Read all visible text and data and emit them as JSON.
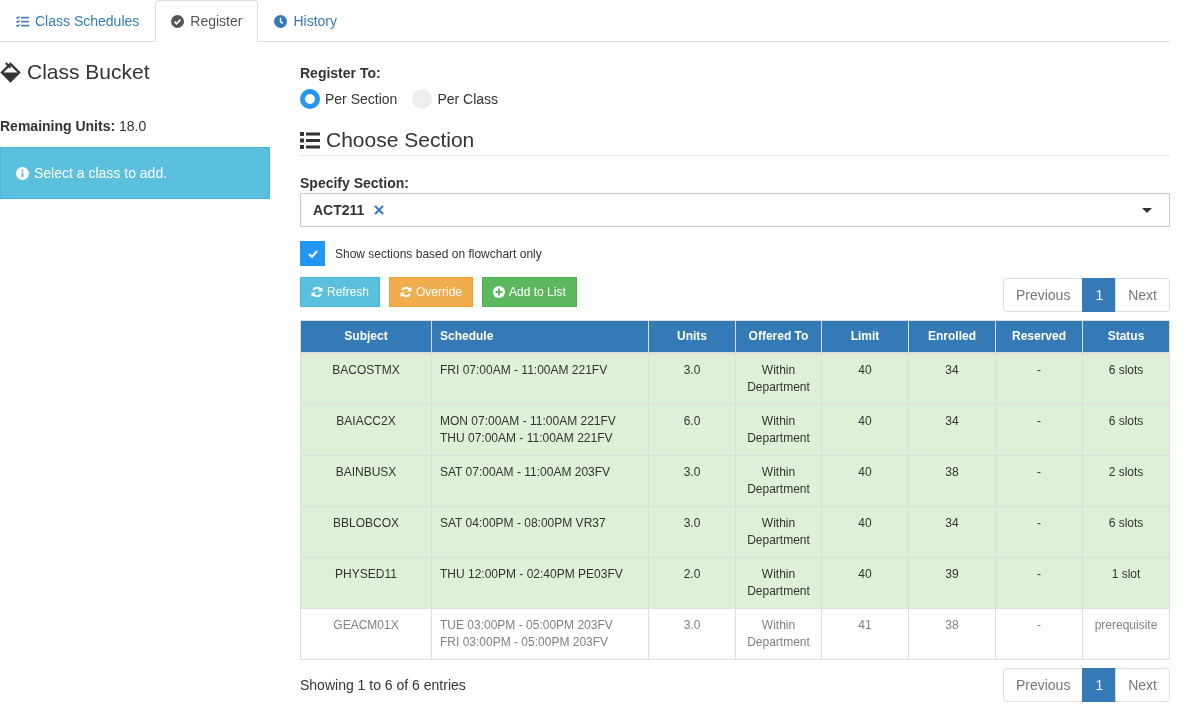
{
  "tabs": [
    {
      "label": "Class Schedules",
      "selected": false
    },
    {
      "label": "Register",
      "selected": true
    },
    {
      "label": "History",
      "selected": false
    }
  ],
  "sidebar": {
    "title": "Class Bucket",
    "remaining_units": "**Remaining Units:** 18.0",
    "alert": "Select a class to add."
  },
  "register_to": {
    "label": "Register To:",
    "options": [
      {
        "label": "Per Section",
        "selected": true
      },
      {
        "label": "Per Class",
        "selected": false
      }
    ]
  },
  "section": {
    "title": "Choose Section",
    "field_label": "Specify Section:",
    "selected_values": [
      "ACT211"
    ],
    "flowchart_only": {
      "label": "Show sections based on flowchart only",
      "checked": true
    }
  },
  "buttons": [
    {
      "label": "Refresh",
      "kind": "info"
    },
    {
      "label": "Override",
      "kind": "warning"
    },
    {
      "label": "Add to List",
      "kind": "success"
    }
  ],
  "pagination_top": {
    "previous": {
      "label": "Previous",
      "disabled": true
    },
    "pages": [
      {
        "label": "1",
        "selected": true
      }
    ],
    "next": {
      "label": "Next",
      "disabled": true
    }
  },
  "table": {
    "columns": [
      "Subject",
      "Schedule",
      "Units",
      "Offered To",
      "Limit",
      "Enrolled",
      "Reserved",
      "Status"
    ],
    "rows": [
      {
        "cells": [
          "BACOSTMX",
          "FRI 07:00AM - 11:00AM 221FV",
          "3.0",
          "Within Department",
          "40",
          "34",
          "-",
          "6 slots"
        ],
        "disabled": false
      },
      {
        "cells": [
          "BAIACC2X",
          "MON 07:00AM - 11:00AM 221FV\nTHU 07:00AM - 11:00AM 221FV",
          "6.0",
          "Within Department",
          "40",
          "34",
          "-",
          "6 slots"
        ],
        "disabled": false
      },
      {
        "cells": [
          "BAINBUSX",
          "SAT 07:00AM - 11:00AM 203FV",
          "3.0",
          "Within Department",
          "40",
          "38",
          "-",
          "2 slots"
        ],
        "disabled": false
      },
      {
        "cells": [
          "BBLOBCOX",
          "SAT 04:00PM - 08:00PM VR37",
          "3.0",
          "Within Department",
          "40",
          "34",
          "-",
          "6 slots"
        ],
        "disabled": false
      },
      {
        "cells": [
          "PHYSED11",
          "THU 12:00PM - 02:40PM PE03FV",
          "2.0",
          "Within Department",
          "40",
          "39",
          "-",
          "1 slot"
        ],
        "disabled": false
      },
      {
        "cells": [
          "GEACM01X",
          "TUE 03:00PM - 05:00PM 203FV\nFRI 03:00PM - 05:00PM 203FV",
          "3.0",
          "Within Department",
          "41",
          "38",
          "-",
          "prerequisite"
        ],
        "disabled": true
      }
    ]
  },
  "footer": {
    "info": "Showing 1 to 6 of 6 entries",
    "pagination": {
      "previous": {
        "label": "Previous",
        "disabled": true
      },
      "pages": [
        {
          "label": "1",
          "selected": true
        }
      ],
      "next": {
        "label": "Next",
        "disabled": true
      }
    }
  }
}
